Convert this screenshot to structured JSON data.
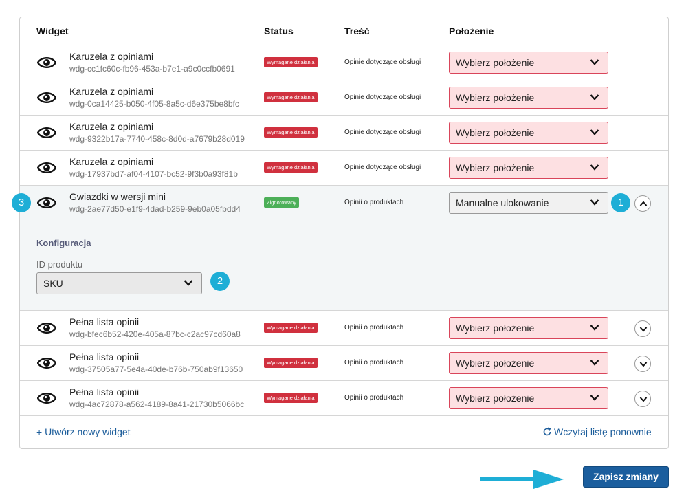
{
  "header": {
    "col_widget": "Widget",
    "col_status": "Status",
    "col_content": "Treść",
    "col_position": "Położenie"
  },
  "rows": [
    {
      "name": "Karuzela z opiniami",
      "id": "wdg-cc1fc60c-fb96-453a-b7e1-a9c0ccfb0691",
      "status": "Wymagane działania",
      "content": "Opinie dotyczące obsługi",
      "position": "Wybierz położenie"
    },
    {
      "name": "Karuzela z opiniami",
      "id": "wdg-0ca14425-b050-4f05-8a5c-d6e375be8bfc",
      "status": "Wymagane działania",
      "content": "Opinie dotyczące obsługi",
      "position": "Wybierz położenie"
    },
    {
      "name": "Karuzela z opiniami",
      "id": "wdg-9322b17a-7740-458c-8d0d-a7679b28d019",
      "status": "Wymagane działania",
      "content": "Opinie dotyczące obsługi",
      "position": "Wybierz położenie"
    },
    {
      "name": "Karuzela z opiniami",
      "id": "wdg-17937bd7-af04-4107-bc52-9f3b0a93f81b",
      "status": "Wymagane działania",
      "content": "Opinie dotyczące obsługi",
      "position": "Wybierz położenie"
    },
    {
      "name": "Gwiazdki w wersji mini",
      "id": "wdg-2ae77d50-e1f9-4dad-b259-9eb0a05fbdd4",
      "status": "Zignorowany",
      "content": "Opinii o produktach",
      "position": "Manualne ulokowanie"
    },
    {
      "name": "Pełna lista opinii",
      "id": "wdg-bfec6b52-420e-405a-87bc-c2ac97cd60a8",
      "status": "Wymagane działania",
      "content": "Opinii o produktach",
      "position": "Wybierz położenie"
    },
    {
      "name": "Pełna lista opinii",
      "id": "wdg-37505a77-5e4a-40de-b76b-750ab9f13650",
      "status": "Wymagane działania",
      "content": "Opinii o produktach",
      "position": "Wybierz położenie"
    },
    {
      "name": "Pełna lista opinii",
      "id": "wdg-4ac72878-a562-4189-8a41-21730b5066bc",
      "status": "Wymagane działania",
      "content": "Opinii o produktach",
      "position": "Wybierz położenie"
    }
  ],
  "config": {
    "title": "Konfiguracja",
    "product_id_label": "ID produktu",
    "product_id_value": "SKU"
  },
  "callouts": {
    "one": "1",
    "two": "2",
    "three": "3"
  },
  "footer": {
    "create_link": "+ Utwórz nowy widget",
    "reload_link": "Wczytaj listę ponownie"
  },
  "save_button": "Zapisz zmiany",
  "icons": {
    "row_icon": "eye-icon",
    "select": "chevron-down-icon",
    "expand": "chevron-down-icon",
    "collapse": "chevron-up-icon",
    "reload": "refresh-icon",
    "pointer": "arrow-right-icon"
  },
  "colors": {
    "status_required": "#d0303e",
    "status_ignored": "#4caf58",
    "select_error_bg": "#fde0e2",
    "callout": "#1eaed6",
    "primary": "#1b5e9e"
  }
}
